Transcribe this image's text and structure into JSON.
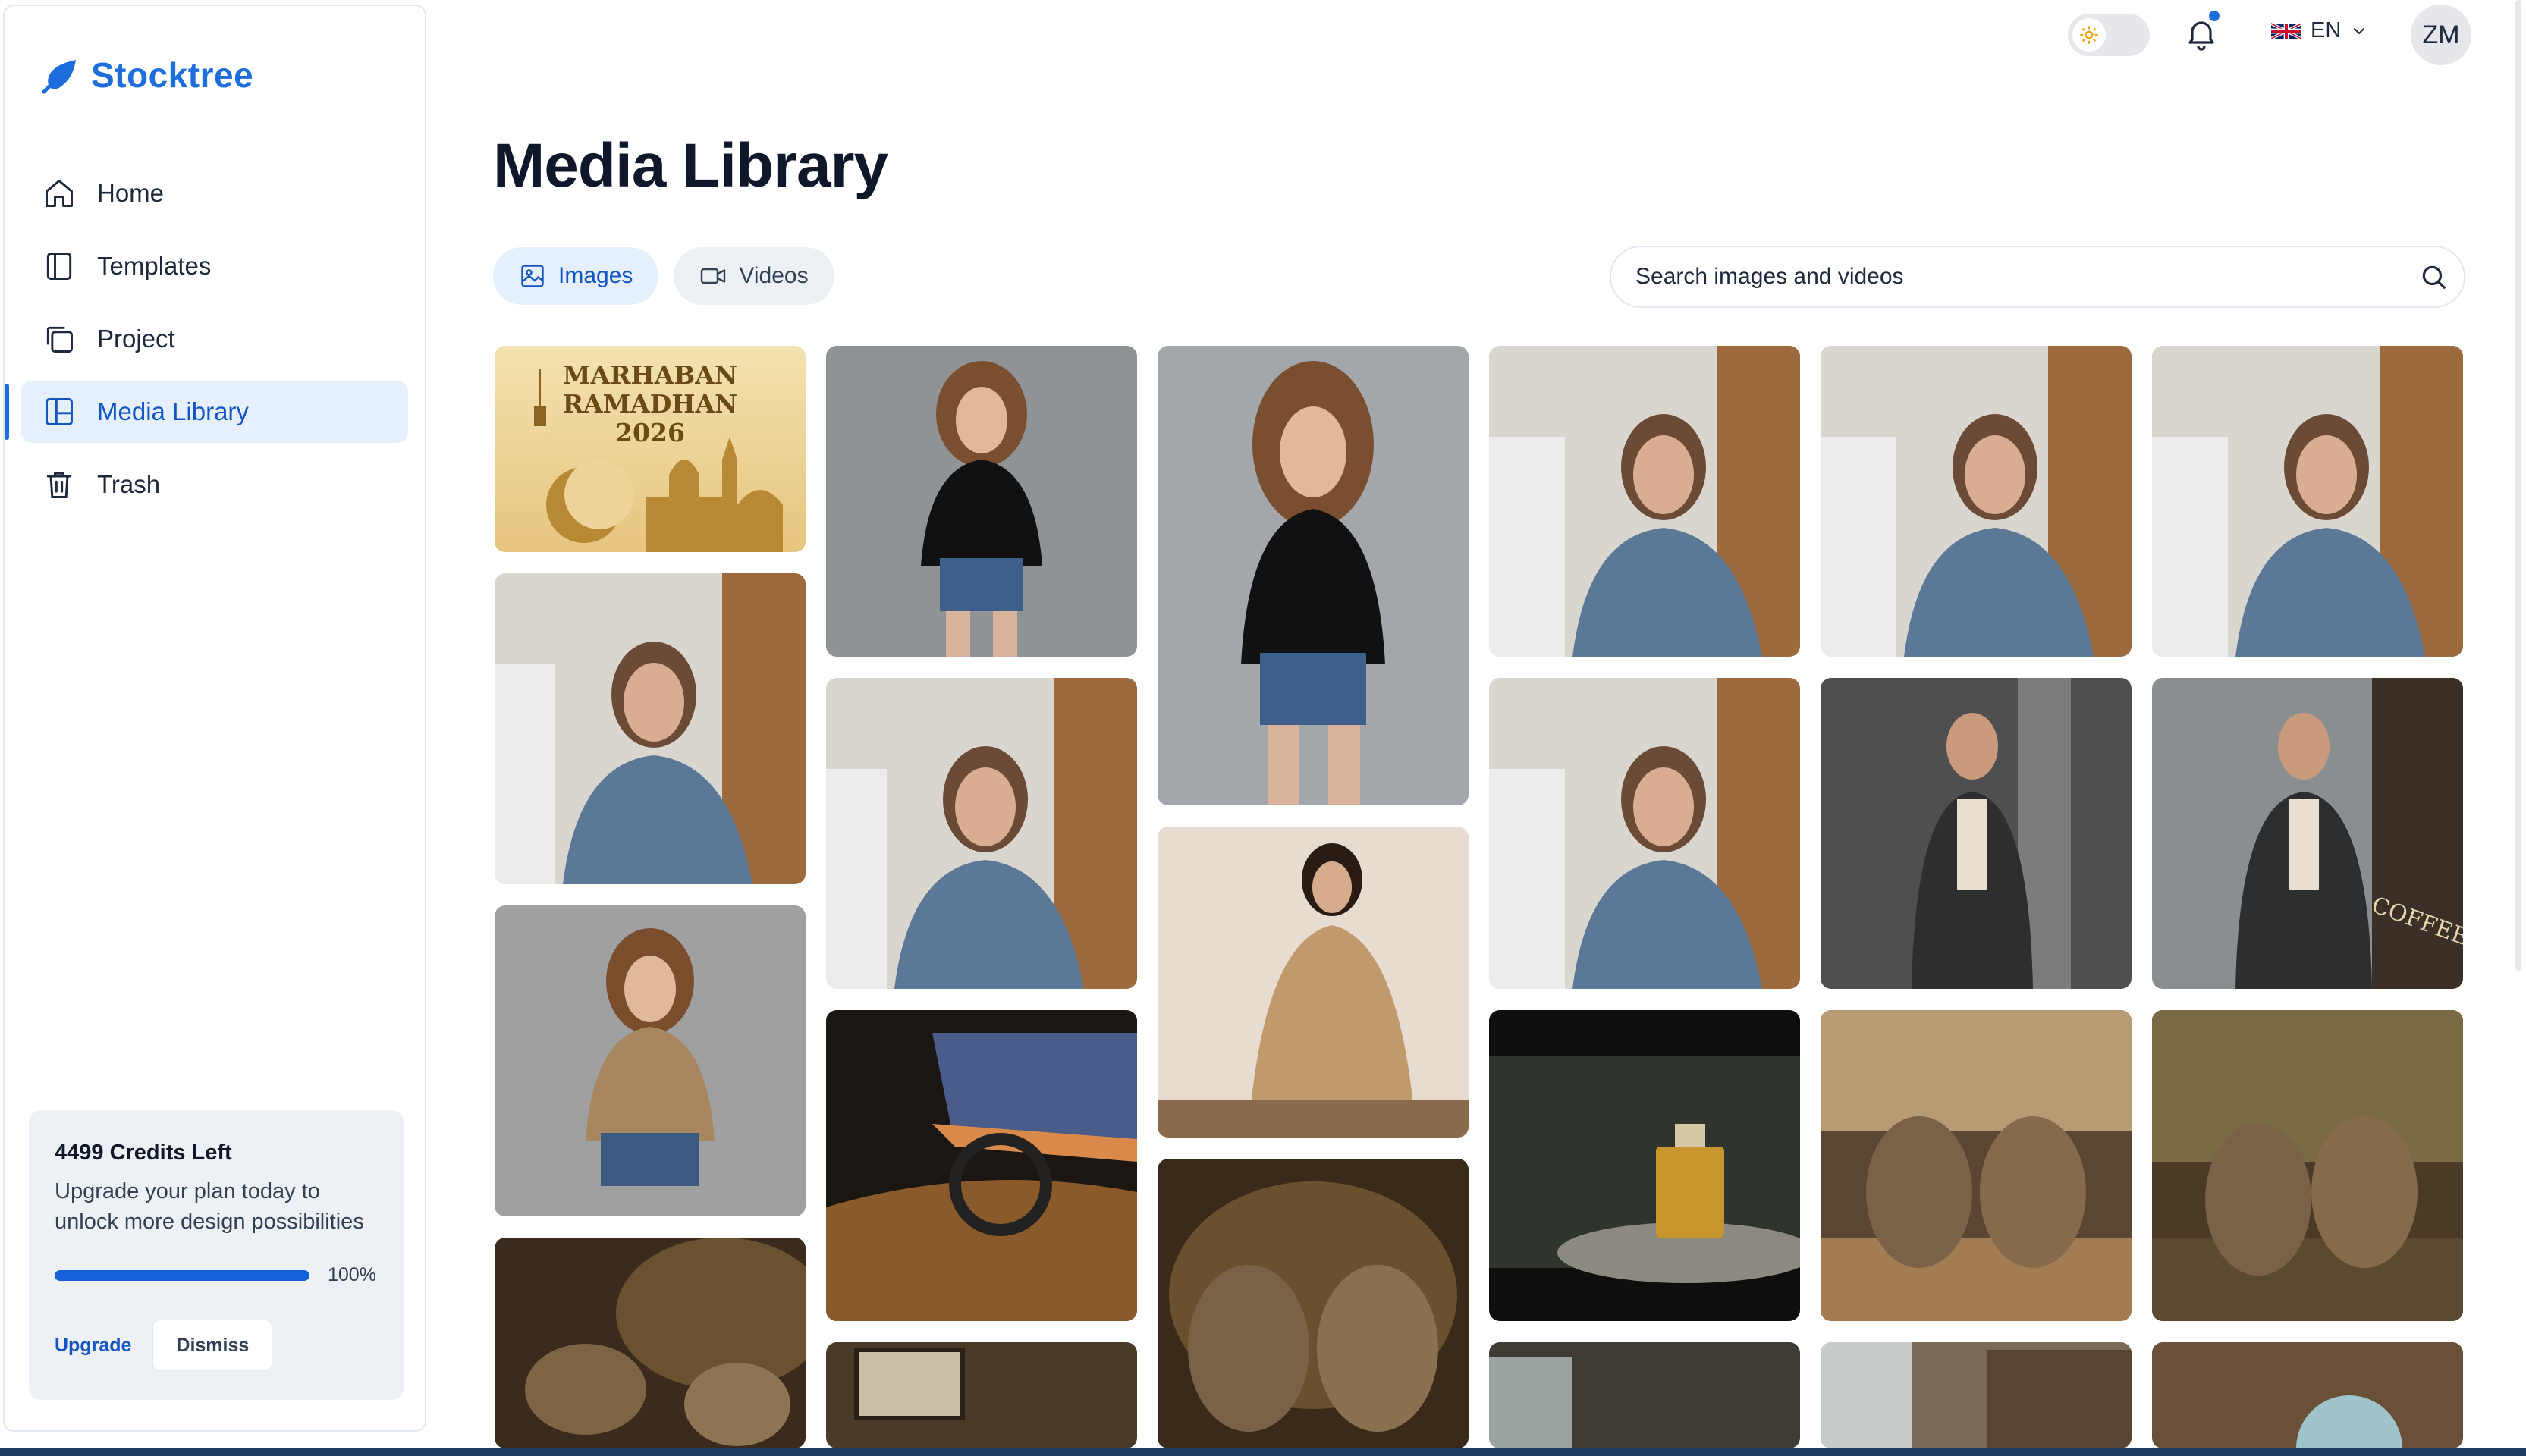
{
  "app": {
    "name": "Stocktree"
  },
  "sidebar": {
    "items": [
      {
        "label": "Home",
        "icon": "home-icon"
      },
      {
        "label": "Templates",
        "icon": "templates-icon"
      },
      {
        "label": "Project",
        "icon": "project-icon"
      },
      {
        "label": "Media Library",
        "icon": "media-library-icon",
        "active": true
      },
      {
        "label": "Trash",
        "icon": "trash-icon"
      }
    ],
    "credits": {
      "title": "4499 Credits Left",
      "description": "Upgrade your plan today to unlock more design possibilities",
      "progress_percent": 100,
      "progress_label": "100%",
      "upgrade_label": "Upgrade",
      "dismiss_label": "Dismiss"
    }
  },
  "topbar": {
    "language": "EN",
    "avatar_initials": "ZM",
    "notification_dot": true
  },
  "main": {
    "title": "Media Library",
    "tabs": [
      {
        "label": "Images",
        "icon": "image-icon",
        "active": true
      },
      {
        "label": "Videos",
        "icon": "video-icon",
        "active": false
      }
    ],
    "search": {
      "placeholder": "Search images and videos",
      "value": ""
    },
    "media": [
      {
        "subject": "ramadan-banner",
        "text_lines": [
          "MARHABAN",
          "RAMADHAN",
          "2026"
        ]
      },
      {
        "subject": "woman-office-blue-shirt"
      },
      {
        "subject": "woman-black-top-denim"
      },
      {
        "subject": "woman-tan-tshirt"
      },
      {
        "subject": "cats-fighting-dust"
      },
      {
        "subject": "woman-black-top-denim"
      },
      {
        "subject": "woman-office-blue-shirt"
      },
      {
        "subject": "car-interior-night"
      },
      {
        "subject": "room-interior"
      },
      {
        "subject": "woman-black-top-denim"
      },
      {
        "subject": "woman-beige-outfit-seated"
      },
      {
        "subject": "cats-fighting-dust"
      },
      {
        "subject": "woman-office-blue-shirt"
      },
      {
        "subject": "woman-office-blue-shirt"
      },
      {
        "subject": "perfume-bottle"
      },
      {
        "subject": "room-interior"
      },
      {
        "subject": "woman-office-blue-shirt"
      },
      {
        "subject": "man-dark-jacket"
      },
      {
        "subject": "cats-fighting-fish"
      },
      {
        "subject": "room-interior"
      },
      {
        "subject": "woman-office-blue-shirt"
      },
      {
        "subject": "man-jacket-coffee-shop",
        "text_lines": [
          "COFFEE"
        ]
      },
      {
        "subject": "cats-fighting-fish-forest"
      },
      {
        "subject": "woman-hijab-room"
      }
    ]
  },
  "colors": {
    "brand": "#1d6ddc",
    "active_bg": "#e6f0fd",
    "credits_bg": "#edf0f4"
  }
}
